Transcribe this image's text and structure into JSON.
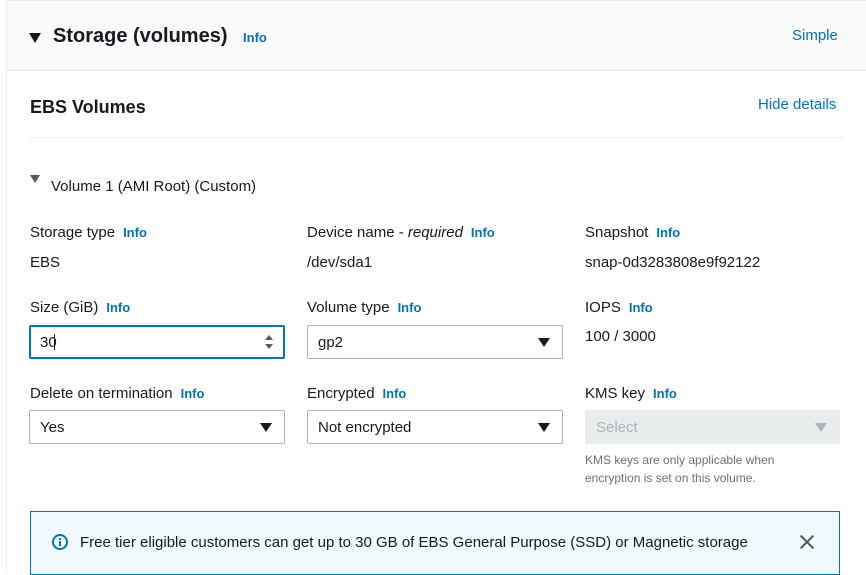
{
  "header": {
    "title": "Storage (volumes)",
    "info": "Info",
    "simple_link": "Simple"
  },
  "ebs": {
    "title": "EBS Volumes",
    "hide_details": "Hide details"
  },
  "volume": {
    "title": "Volume 1 (AMI Root) (Custom)",
    "storage_type": {
      "label": "Storage type",
      "info": "Info",
      "value": "EBS"
    },
    "device_name": {
      "label": "Device name - ",
      "required": "required",
      "info": "Info",
      "value": "/dev/sda1"
    },
    "snapshot": {
      "label": "Snapshot",
      "info": "Info",
      "value": "snap-0d3283808e9f92122"
    },
    "size": {
      "label": "Size (GiB)",
      "info": "Info",
      "value": "30"
    },
    "volume_type": {
      "label": "Volume type",
      "info": "Info",
      "value": "gp2"
    },
    "iops": {
      "label": "IOPS",
      "info": "Info",
      "value": "100 / 3000"
    },
    "delete_on_termination": {
      "label": "Delete on termination",
      "info": "Info",
      "value": "Yes"
    },
    "encrypted": {
      "label": "Encrypted",
      "info": "Info",
      "value": "Not encrypted"
    },
    "kms_key": {
      "label": "KMS key",
      "info": "Info",
      "placeholder": "Select",
      "hint": "KMS keys are only applicable when encryption is set on this volume."
    }
  },
  "alert": {
    "text": "Free tier eligible customers can get up to 30 GB of EBS General Purpose (SSD) or Magnetic storage"
  },
  "colors": {
    "link": "#0073bb",
    "text": "#16191f",
    "alert_bg": "#f1faff",
    "disabled_bg": "#eaeded"
  },
  "icons": [
    "caret-down-icon",
    "info-circle-icon",
    "close-icon",
    "stepper-icon",
    "dropdown-arrow-icon"
  ]
}
